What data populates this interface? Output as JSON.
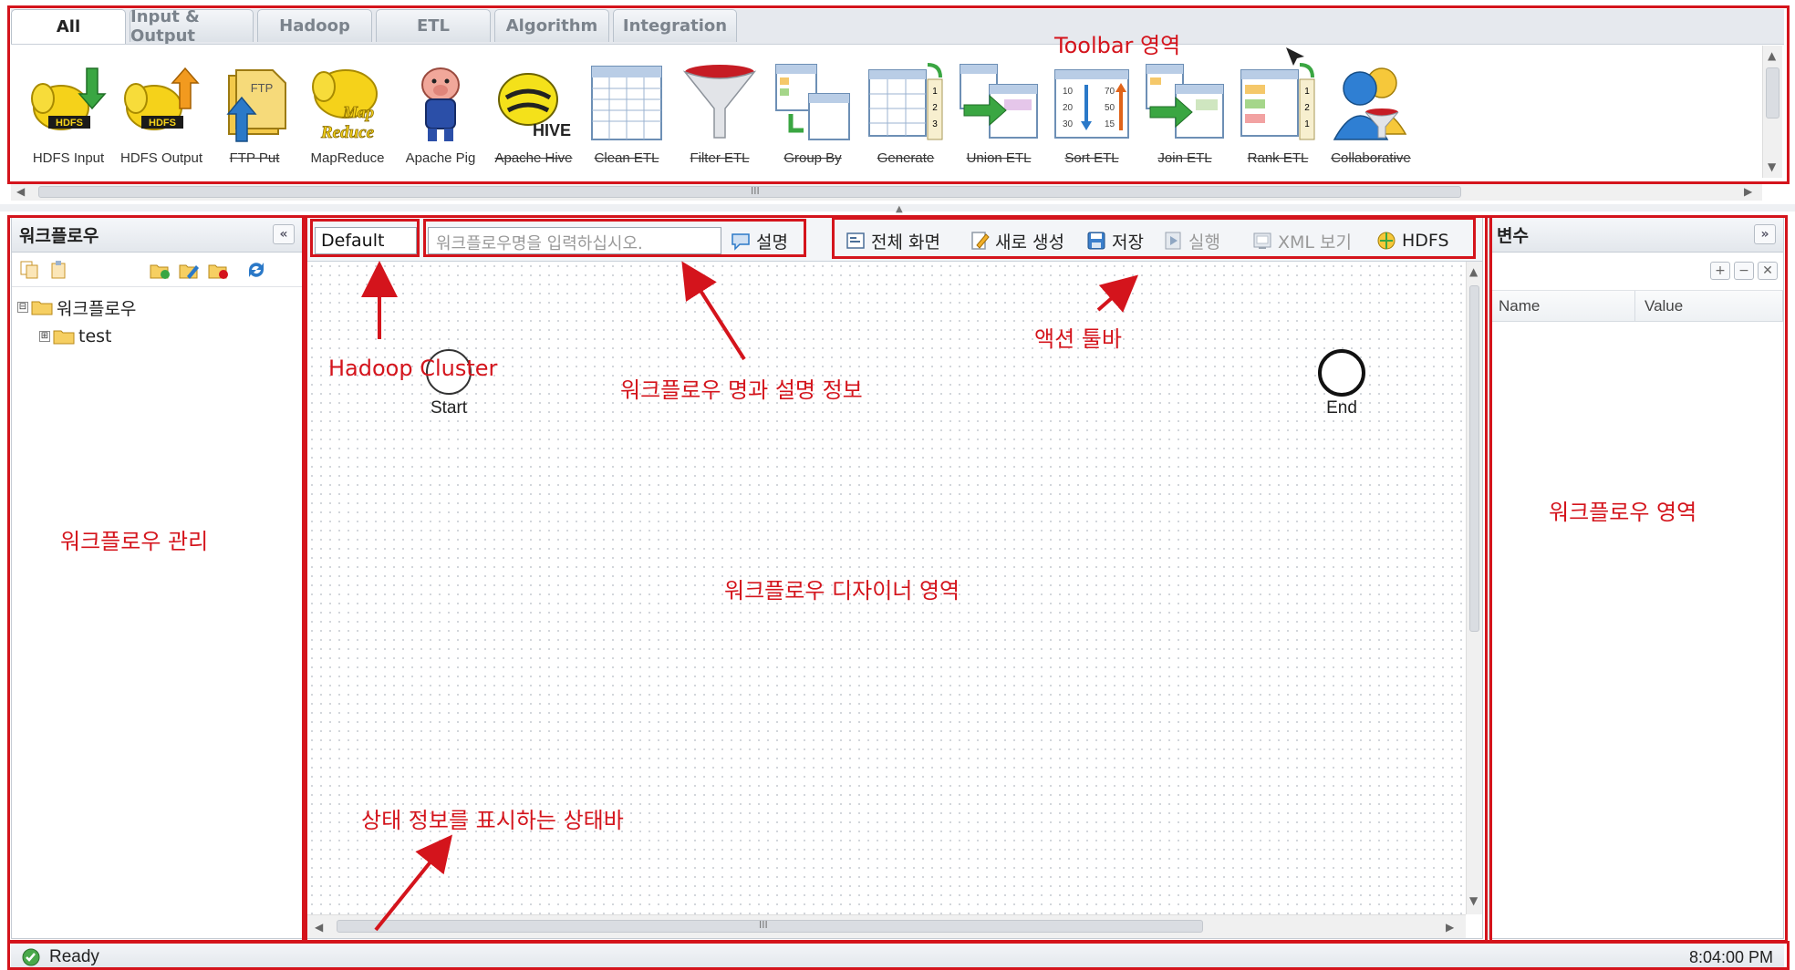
{
  "palette": {
    "tabs": [
      {
        "label": "All",
        "active": true
      },
      {
        "label": "Input & Output",
        "active": false
      },
      {
        "label": "Hadoop",
        "active": false
      },
      {
        "label": "ETL",
        "active": false
      },
      {
        "label": "Algorithm",
        "active": false
      },
      {
        "label": "Integration",
        "active": false
      }
    ],
    "items": [
      {
        "label": "HDFS Input",
        "icon": "hdfs-input-icon",
        "enabled": true
      },
      {
        "label": "HDFS Output",
        "icon": "hdfs-output-icon",
        "enabled": true
      },
      {
        "label": "FTP Put",
        "icon": "ftp-put-icon",
        "enabled": false
      },
      {
        "label": "MapReduce",
        "icon": "mapreduce-icon",
        "enabled": true
      },
      {
        "label": "Apache Pig",
        "icon": "apache-pig-icon",
        "enabled": true
      },
      {
        "label": "Apache Hive",
        "icon": "apache-hive-icon",
        "enabled": false
      },
      {
        "label": "Clean ETL",
        "icon": "clean-etl-icon",
        "enabled": false
      },
      {
        "label": "Filter ETL",
        "icon": "filter-etl-icon",
        "enabled": false
      },
      {
        "label": "Group By",
        "icon": "group-by-etl-icon",
        "enabled": false
      },
      {
        "label": "Generate",
        "icon": "generate-etl-icon",
        "enabled": false
      },
      {
        "label": "Union ETL",
        "icon": "union-etl-icon",
        "enabled": false
      },
      {
        "label": "Sort ETL",
        "icon": "sort-etl-icon",
        "enabled": false
      },
      {
        "label": "Join ETL",
        "icon": "join-etl-icon",
        "enabled": false
      },
      {
        "label": "Rank ETL",
        "icon": "rank-etl-icon",
        "enabled": false
      },
      {
        "label": "Collaborative",
        "icon": "collaborative-filtering-icon",
        "enabled": false
      }
    ],
    "hscroll_glyph": "III"
  },
  "left_panel": {
    "title": "워크플로우",
    "collapse_glyph": "«",
    "tree": [
      {
        "label": "워크플로우",
        "toggle": "⊟",
        "level": 0
      },
      {
        "label": "test",
        "toggle": "⊞",
        "level": 1
      }
    ]
  },
  "designer": {
    "cluster": "Default",
    "name_placeholder": "워크플로우명을 입력하십시오.",
    "description_button": "설명",
    "actions": [
      {
        "label": "전체 화면",
        "icon": "fullscreen-icon",
        "enabled": true
      },
      {
        "label": "새로 생성",
        "icon": "new-icon",
        "enabled": true
      },
      {
        "label": "저장",
        "icon": "save-icon",
        "enabled": true
      },
      {
        "label": "실행",
        "icon": "run-icon",
        "enabled": false
      },
      {
        "label": "XML 보기",
        "icon": "xml-view-icon",
        "enabled": false
      },
      {
        "label": "HDFS",
        "icon": "hdfs-browser-icon",
        "enabled": true
      }
    ],
    "nodes": {
      "start": "Start",
      "end": "End"
    },
    "hscroll_glyph": "III"
  },
  "right_panel": {
    "title": "변수",
    "collapse_glyph": "»",
    "columns": [
      "Name",
      "Value"
    ],
    "tools": [
      "+",
      "−",
      "✕"
    ]
  },
  "status": {
    "text": "Ready",
    "time": "8:04:00 PM"
  },
  "annotations": {
    "toolbar_area": "Toolbar 영역",
    "hadoop_cluster": "Hadoop Cluster",
    "workflow_name_desc": "워크플로우 명과 설명 정보",
    "action_toolbar": "액션 툴바",
    "workflow_management": "워크플로우 관리",
    "designer_area": "워크플로우 디자이너 영역",
    "status_bar_desc": "상태 정보를 표시하는 상태바",
    "workflow_area": "워크플로우 영역"
  },
  "colors": {
    "annotation": "#d4141c",
    "accent": "#2b79c8"
  }
}
